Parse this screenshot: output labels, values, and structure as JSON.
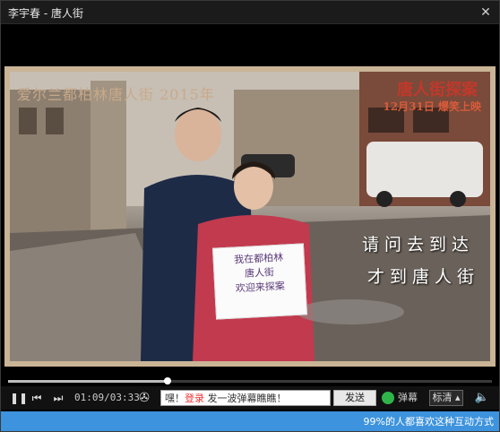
{
  "window": {
    "title": "李宇春 - 唐人街",
    "close_icon": "close-icon"
  },
  "video": {
    "caption_top_left": "爱尔兰都柏林唐人街 2015年",
    "poster_title": "唐人街探案",
    "poster_subtitle": "12月31日 爆笑上映",
    "handwritten_line1": "请问去到达",
    "handwritten_line2": "才到唐人街",
    "sign_lines": [
      "我在都柏林",
      "唐人街",
      "欢迎来探案"
    ]
  },
  "player": {
    "progress_fraction": 0.33,
    "time": "01:09/03:33",
    "danmu_prefix": "嘿！",
    "danmu_login": "登录",
    "danmu_text": " 发一波弹幕瞧瞧！",
    "send_label": "发送",
    "danmu_toggle_label": "弹幕",
    "quality_label": "标清",
    "icons": {
      "play": "pause-icon",
      "prev": "previous-icon",
      "next": "next-icon",
      "reel": "film-reel-icon",
      "volume": "volume-icon"
    }
  },
  "footer": {
    "promo_text": "99%的人都喜欢这种互动方式"
  }
}
